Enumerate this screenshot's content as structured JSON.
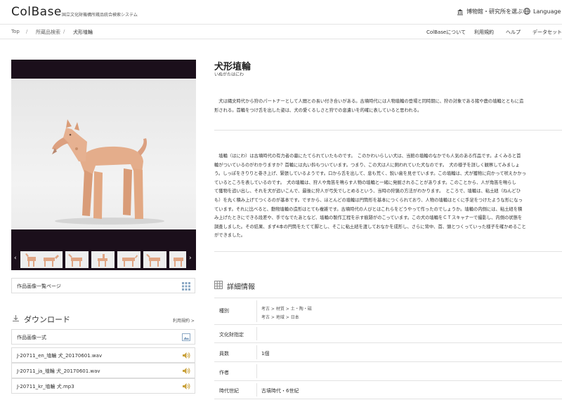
{
  "header": {
    "logo": "ColBase",
    "logo_sub": "国立文化財機構所蔵品統合検索システム",
    "museum_select": "博物館・研究所を選ぶ",
    "language": "Language"
  },
  "breadcrumb": {
    "items": [
      "Top",
      "所蔵品検索",
      "犬形埴輪"
    ],
    "separator": "/"
  },
  "nav": {
    "links": [
      "ColBaseについて",
      "利用規約",
      "ヘルプ",
      "データセット"
    ]
  },
  "sidebar": {
    "gallery_link": "作品画像一覧ページ",
    "download_title": "ダウンロード",
    "terms_link": "利用規約 >",
    "files": [
      "作品画像一式",
      "J-20711_en_埴輪 犬_20170601.wav",
      "J-20711_ja_埴輪 犬_20170601.wav",
      "J-20711_kr_埴輪 犬.mp3"
    ]
  },
  "main": {
    "title": "犬形埴輪",
    "kana": "いぬがたはにわ",
    "para1": [
      "　犬は縄文時代から狩のパートナーとして人間との長い付き合いがある。古墳時代には人物埴輪の登場と同時期に、狩の対象である猪や鹿の埴輪とともに造",
      "形される。首輪をつけ舌を出した姿は、犬の愛くるしさと狩での息遣いを的確に表していると思われる。"
    ],
    "para2": [
      "　埴輪（はにわ）は古墳時代の有力者の墓にたてられていたものです。　このかわいらしい犬は、当館の埴輪のなかでも人気のある作品です。よくみると首",
      "輪がついているのがわかりますか？首輪には丸い鈴もついています。つまり、この犬は人に飼われていた犬なのです。　犬の様子を詳しく観察してみましょ",
      "う。しっぽをきりりと巻き上げ、緊張しているようです。口から舌を出して、息も荒く、鋭い歯を見せています。この埴輪は、犬が獲物に向かって吠えかかっ",
      "ているところを表しているのです。　犬の埴輪は、狩人や角笛を鳴らす人物の埴輪と一緒に発掘されることがあります。このことから、人が角笛を鳴らし",
      "て獲物を追い出し、それを犬が追いこんで、最後に狩人が弓矢でしとめるという、当時の狩猟の方法がわかります。　ところで、埴輪は、粘土紐（ねんどひ",
      "も）を丸く積み上げてつくるのが基本です。ですから、ほとんどの埴輪は円筒形を基本につくられており、人物の埴輪はとくに手足をつけたような形になっ",
      "ています。それに比べると、動物埴輪の造形はとても複雑です。古墳時代の人びとはこれらをどうやって作ったのでしょうか。埴輪の内側には、粘土紐を積",
      "み上げたときにできる段差や、手でなでたあとなど、埴輪の製作工程を示す痕跡がのこっています。この犬の埴輪をＣＴスキャナーで撮影し、内側の状態を",
      "調査しました。その結果、まず4本の円筒をたてて脚とし、そこに粘土紐を渡しておなかを成形し、さらに背中、首、頭とつくっていった様子を確かめること",
      "ができました。"
    ]
  },
  "details": {
    "title": "詳細情報",
    "rows": [
      {
        "key": "種別",
        "cls1": [
          "考古",
          "材質",
          "土・陶・磁"
        ],
        "cls2": [
          "考古",
          "地域",
          "日本"
        ]
      },
      {
        "key": "文化財指定",
        "value": ""
      },
      {
        "key": "員数",
        "value": "1個"
      },
      {
        "key": "作者",
        "value": ""
      },
      {
        "key": "時代世紀",
        "value": "古墳時代・6世紀"
      }
    ]
  },
  "colors": {
    "photo_bg": "#1b0f1b",
    "accent_icon": "#c9a13b",
    "grid_icon": "#8aa7c4"
  }
}
